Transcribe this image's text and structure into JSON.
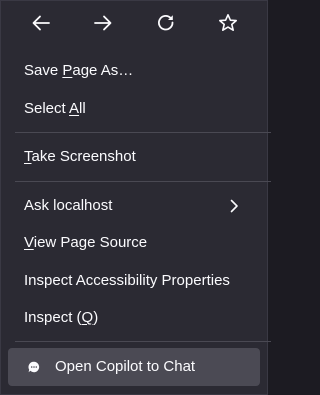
{
  "nav": {
    "back_icon": "arrow-left-icon",
    "forward_icon": "arrow-right-icon",
    "reload_icon": "reload-icon",
    "bookmark_icon": "star-icon"
  },
  "menu": {
    "save_page_as": {
      "pre": "Save ",
      "key": "P",
      "post": "age As…"
    },
    "select_all": {
      "pre": "Select ",
      "key": "A",
      "post": "ll"
    },
    "take_screenshot": {
      "pre": "",
      "key": "T",
      "post": "ake Screenshot"
    },
    "ask_localhost": {
      "pre": "Ask localhost",
      "key": "",
      "post": "",
      "submenu_icon": "chevron-right-icon"
    },
    "view_page_source": {
      "pre": "",
      "key": "V",
      "post": "iew Page Source"
    },
    "inspect_accessibility": {
      "pre": "Inspect Accessibility Properties",
      "key": "",
      "post": ""
    },
    "inspect": {
      "pre": "Inspect (",
      "key": "Q",
      "post": ")"
    },
    "open_copilot": {
      "label": "Open Copilot to Chat",
      "icon": "chat-bubble-icon"
    }
  },
  "colors": {
    "menu_background": "#2b2a33",
    "text": "#fbfbfe",
    "separator": "#4a4953",
    "highlight": "#4b4a54"
  }
}
